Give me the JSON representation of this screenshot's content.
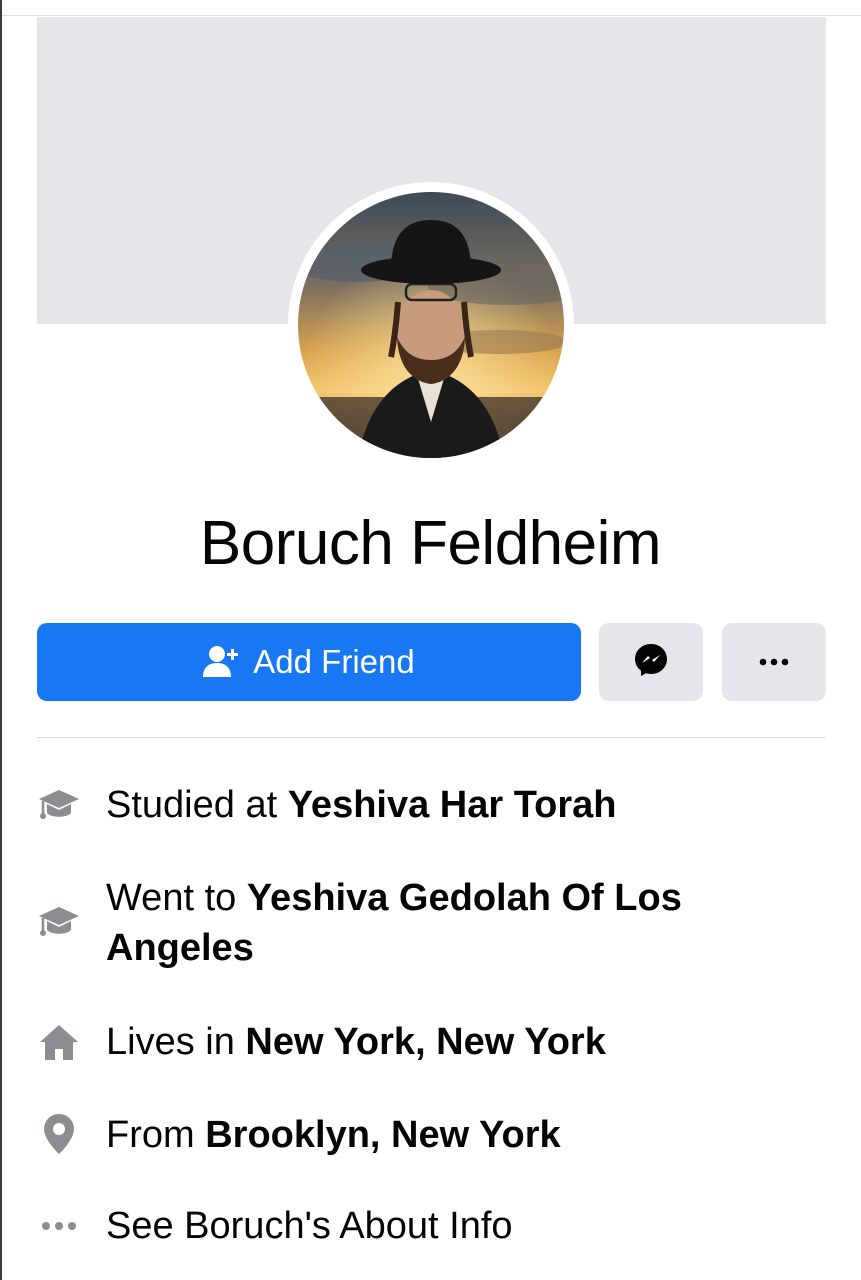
{
  "profile": {
    "name": "Boruch Feldheim"
  },
  "actions": {
    "add_friend_label": "Add Friend",
    "add_friend_icon": "add-person-icon",
    "message_icon": "messenger-icon",
    "more_icon": "more-dots-icon"
  },
  "intro": {
    "studied": {
      "prefix": "Studied at ",
      "value": "Yeshiva Har Torah",
      "icon": "graduation-cap-icon"
    },
    "went": {
      "prefix": "Went to ",
      "value": "Yeshiva Gedolah Of Los Angeles",
      "icon": "graduation-cap-icon"
    },
    "lives": {
      "prefix": "Lives in ",
      "value": "New York, New York",
      "icon": "home-icon"
    },
    "from": {
      "prefix": "From ",
      "value": "Brooklyn, New York",
      "icon": "location-pin-icon"
    },
    "about": {
      "label": "See Boruch's About Info",
      "icon": "more-dots-icon"
    }
  },
  "colors": {
    "primary": "#1877f2",
    "secondary_button": "#e4e6eb",
    "icon_gray": "#8a8d91",
    "text": "#050505"
  }
}
